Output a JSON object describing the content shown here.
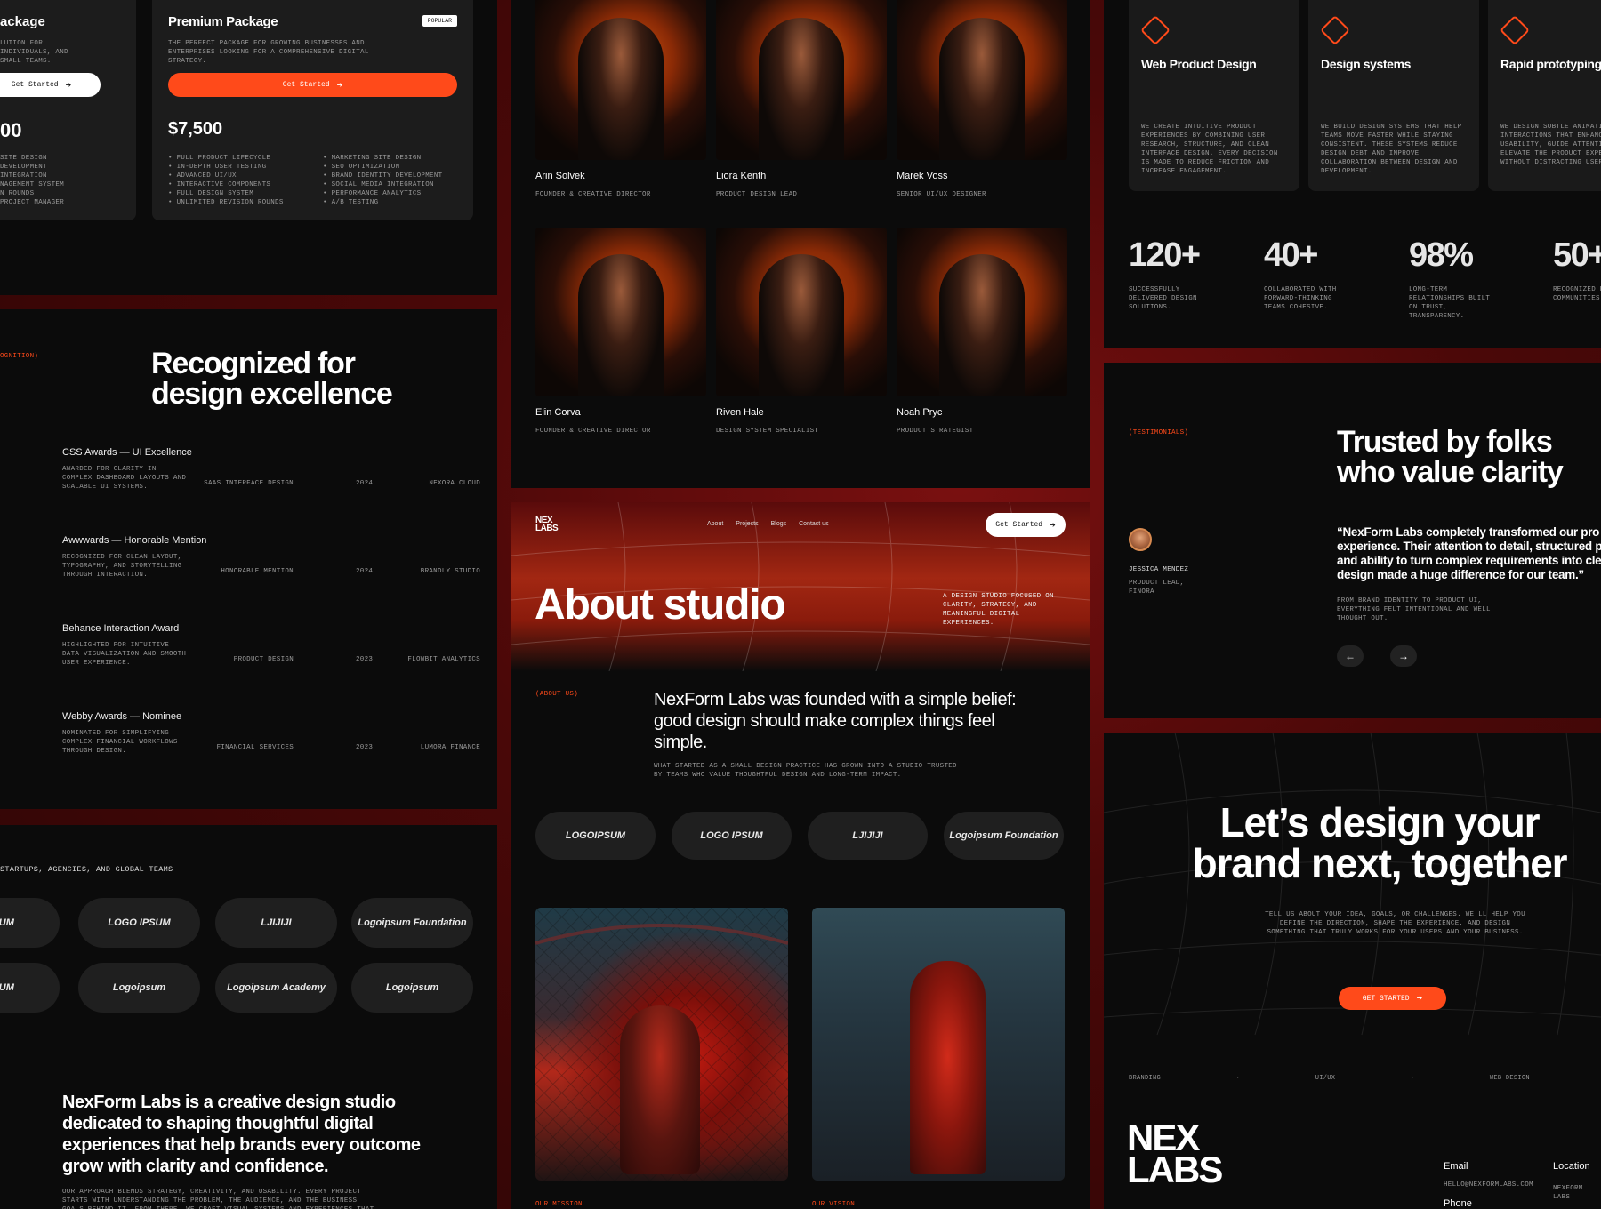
{
  "pricing": {
    "left_title": "ackage",
    "left_desc": "LUTION FOR INDIVIDUALS, AND SMALL TEAMS.",
    "left_button": "Get Started",
    "left_price": "00",
    "left_features": [
      "SITE DESIGN",
      "DEVELOPMENT",
      "INTEGRATION",
      "NAGEMENT SYSTEM",
      "N ROUNDS",
      "PROJECT MANAGER"
    ],
    "premium_title": "Premium Package",
    "premium_badge": "POPULAR",
    "premium_desc": "THE PERFECT PACKAGE FOR GROWING BUSINESSES AND ENTERPRISES LOOKING FOR A COMPREHENSIVE DIGITAL STRATEGY.",
    "premium_button": "Get Started",
    "premium_price": "$7,500",
    "premium_features_a": [
      "• FULL PRODUCT LIFECYCLE",
      "• IN-DEPTH USER TESTING",
      "• ADVANCED UI/UX",
      "• INTERACTIVE COMPONENTS",
      "• FULL DESIGN SYSTEM",
      "• UNLIMITED REVISION ROUNDS"
    ],
    "premium_features_b": [
      "• MARKETING SITE DESIGN",
      "• SEO OPTIMIZATION",
      "• BRAND IDENTITY DEVELOPMENT",
      "• SOCIAL MEDIA INTEGRATION",
      "• PERFORMANCE ANALYTICS",
      "• A/B TESTING"
    ]
  },
  "recognition": {
    "tag": "OGNITION)",
    "title": "Recognized for design excellence",
    "awards": [
      {
        "title": "CSS Awards — UI Excellence",
        "desc": "AWARDED FOR CLARITY IN COMPLEX DASHBOARD LAYOUTS AND SCALABLE UI SYSTEMS.",
        "category": "SAAS INTERFACE DESIGN",
        "year": "2024",
        "client": "NEXORA CLOUD"
      },
      {
        "title": "Awwwards — Honorable Mention",
        "desc": "RECOGNIZED FOR CLEAN LAYOUT, TYPOGRAPHY, AND STORYTELLING THROUGH INTERACTION.",
        "category": "HONORABLE MENTION",
        "year": "2024",
        "client": "BRANDLY STUDIO"
      },
      {
        "title": "Behance Interaction Award",
        "desc": "HIGHLIGHTED FOR INTUITIVE DATA VISUALIZATION AND SMOOTH USER EXPERIENCE.",
        "category": "PRODUCT DESIGN",
        "year": "2023",
        "client": "FLOWBIT ANALYTICS"
      },
      {
        "title": "Webby Awards — Nominee",
        "desc": "NOMINATED FOR SIMPLIFYING COMPLEX FINANCIAL WORKFLOWS THROUGH DESIGN.",
        "category": "FINANCIAL SERVICES",
        "year": "2023",
        "client": "LUMORA FINANCE"
      }
    ]
  },
  "clients": {
    "tag": "STARTUPS, AGENCIES, AND GLOBAL TEAMS",
    "logos": [
      "IPSUM",
      "LOGO IPSUM",
      "LJIJIJI",
      "Logoipsum Foundation",
      "IPSUM",
      "Logoipsum",
      "Logoipsum Academy",
      "Logoipsum"
    ],
    "statement": "NexForm Labs is a creative design studio dedicated to shaping thoughtful digital experiences that help brands every outcome grow with clarity and confidence.",
    "statement_sub": "OUR APPROACH BLENDS STRATEGY, CREATIVITY, AND USABILITY. EVERY PROJECT STARTS WITH UNDERSTANDING THE PROBLEM, THE AUDIENCE, AND THE BUSINESS GOALS BEHIND IT. FROM THERE, WE CRAFT VISUAL SYSTEMS AND EXPERIENCES THAT NOT ONLY LOOK REFINED BUT ALSO"
  },
  "team": {
    "members": [
      {
        "name": "Arin Solvek",
        "role": "FOUNDER & CREATIVE DIRECTOR"
      },
      {
        "name": "Liora Kenth",
        "role": "PRODUCT DESIGN LEAD"
      },
      {
        "name": "Marek Voss",
        "role": "SENIOR UI/UX DESIGNER"
      },
      {
        "name": "Elin Corva",
        "role": "FOUNDER & CREATIVE DIRECTOR"
      },
      {
        "name": "Riven Hale",
        "role": "DESIGN SYSTEM SPECIALIST"
      },
      {
        "name": "Noah Pryc",
        "role": "PRODUCT STRATEGIST"
      }
    ]
  },
  "about": {
    "logo_line1": "NEX",
    "logo_line2": "LABS",
    "nav": [
      "About",
      "Projects",
      "Blogs",
      "Contact us"
    ],
    "cta": "Get Started",
    "title": "About studio",
    "hero_desc": "A DESIGN STUDIO FOCUSED ON CLARITY, STRATEGY, AND MEANINGFUL DIGITAL EXPERIENCES.",
    "tag": "(ABOUT US)",
    "headline": "NexForm Labs was founded with a simple belief: good design should make complex things feel simple.",
    "sub": "WHAT STARTED AS A SMALL DESIGN PRACTICE HAS GROWN INTO A STUDIO TRUSTED BY TEAMS WHO VALUE THOUGHTFUL DESIGN AND LONG-TERM IMPACT.",
    "logos": [
      "LOGOIPSUM",
      "LOGO IPSUM",
      "LJIJIJI",
      "Logoipsum Foundation"
    ],
    "bottom_tag_1": "OUR MISSION",
    "bottom_tag_2": "OUR VISION"
  },
  "services": [
    {
      "title": "Web Product Design",
      "desc": "WE CREATE INTUITIVE PRODUCT EXPERIENCES BY COMBINING USER RESEARCH, STRUCTURE, AND CLEAN INTERFACE DESIGN. EVERY DECISION IS MADE TO REDUCE FRICTION AND INCREASE ENGAGEMENT."
    },
    {
      "title": "Design systems",
      "desc": "WE BUILD DESIGN SYSTEMS THAT HELP TEAMS MOVE FASTER WHILE STAYING CONSISTENT. THESE SYSTEMS REDUCE DESIGN DEBT AND IMPROVE COLLABORATION BETWEEN DESIGN AND DEVELOPMENT."
    },
    {
      "title": "Rapid prototyping",
      "desc": "WE DESIGN SUBTLE ANIMATIONS AND INTERACTIONS THAT ENHANCE USABILITY, GUIDE ATTENTION, AND ELEVATE THE PRODUCT EXPERIENCE WITHOUT DISTRACTING USERS."
    }
  ],
  "stats": [
    {
      "n": "120+",
      "d": "SUCCESSFULLY DELIVERED DESIGN SOLUTIONS."
    },
    {
      "n": "40+",
      "d": "COLLABORATED WITH FORWARD-THINKING TEAMS COHESIVE."
    },
    {
      "n": "98%",
      "d": "LONG-TERM RELATIONSHIPS BUILT ON TRUST, TRANSPARENCY."
    },
    {
      "n": "50+",
      "d": "RECOGNIZED BY COMMUNITIES F"
    }
  ],
  "testimonials": {
    "tag": "(TESTIMONIALS)",
    "title": "Trusted by folks who value clarity",
    "person": "JESSICA MENDEZ",
    "person_role": "PRODUCT LEAD, FINORA",
    "quote": "“NexForm Labs completely transformed our pro experience. Their attention to detail, structured p and ability to turn complex requirements into cle design made a huge difference for our team.”",
    "quote_sub": "FROM BRAND IDENTITY TO PRODUCT UI, EVERYTHING FELT INTENTIONAL AND WELL THOUGHT OUT."
  },
  "cta": {
    "title": "Let’s design your brand next, together",
    "desc": "TELL US ABOUT YOUR IDEA, GOALS, OR CHALLENGES. WE'LL HELP YOU DEFINE THE DIRECTION, SHAPE THE EXPERIENCE, AND DESIGN SOMETHING THAT TRULY WORKS FOR YOUR USERS AND YOUR BUSINESS.",
    "button": "GET STARTED",
    "marquee": [
      "BRANDING",
      "·",
      "UI/UX",
      "·",
      "WEB DESIGN",
      "·"
    ]
  },
  "footer": {
    "logo_line1": "NEX",
    "logo_line2": "LABS",
    "email_label": "Email",
    "email": "HELLO@NEXFORMLABS.COM",
    "phone_label": "Phone",
    "location_label": "Location",
    "location": "NEXFORM LABS"
  }
}
